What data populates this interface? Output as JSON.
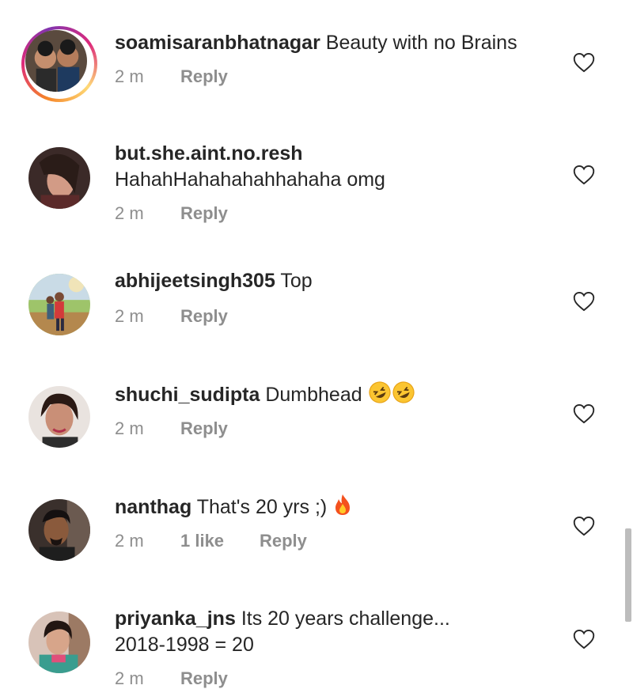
{
  "comments": [
    {
      "username": "soamisaranbhatnagar",
      "text": "Beauty with no Brains",
      "time": "2 m",
      "reply_label": "Reply",
      "has_story": true
    },
    {
      "username": "but.she.aint.no.resh",
      "text": "HahahHahahahahhahaha omg",
      "time": "2 m",
      "reply_label": "Reply"
    },
    {
      "username": "abhijeetsingh305",
      "text": "Top",
      "time": "2 m",
      "reply_label": "Reply"
    },
    {
      "username": "shuchi_sudipta",
      "text": "Dumbhead",
      "emoji": [
        "rofl-emoji",
        "rofl-emoji"
      ],
      "time": "2 m",
      "reply_label": "Reply"
    },
    {
      "username": "nanthag",
      "text": "That's 20 yrs ;)",
      "emoji": [
        "fire-emoji"
      ],
      "time": "2 m",
      "likes_label": "1 like",
      "reply_label": "Reply"
    },
    {
      "username": "priyanka_jns",
      "text": "Its 20 years challenge...",
      "text_line2": "2018-1998 = 20",
      "time": "2 m",
      "reply_label": "Reply"
    }
  ],
  "icons": {
    "like": "heart-outline-icon"
  },
  "colors": {
    "text": "#262626",
    "meta": "#8e8e8e",
    "story_ring": [
      "#f58529",
      "#dd2a7b",
      "#8134af"
    ]
  }
}
